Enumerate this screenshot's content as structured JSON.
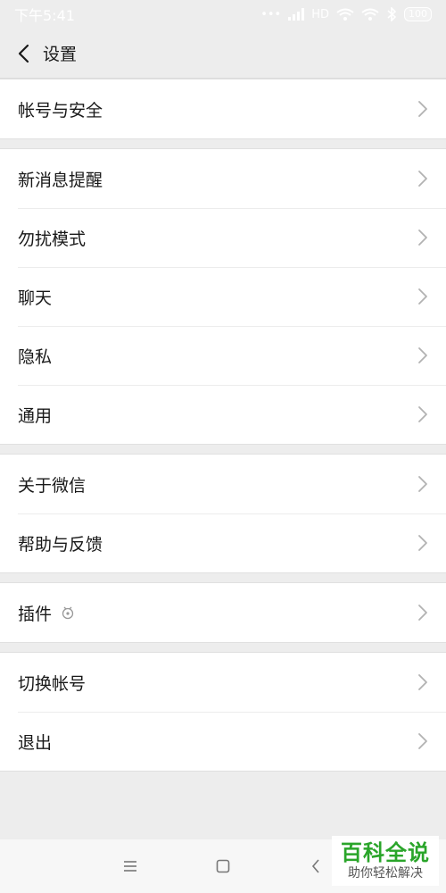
{
  "status_bar": {
    "time": "下午5:41",
    "network": "HD",
    "battery": "100"
  },
  "header": {
    "title": "设置"
  },
  "groups": [
    {
      "items": [
        {
          "label": "帐号与安全"
        }
      ]
    },
    {
      "items": [
        {
          "label": "新消息提醒"
        },
        {
          "label": "勿扰模式"
        },
        {
          "label": "聊天"
        },
        {
          "label": "隐私"
        },
        {
          "label": "通用"
        }
      ]
    },
    {
      "items": [
        {
          "label": "关于微信"
        },
        {
          "label": "帮助与反馈"
        }
      ]
    },
    {
      "items": [
        {
          "label": "插件",
          "icon": "plugin-icon"
        }
      ]
    },
    {
      "items": [
        {
          "label": "切换帐号"
        },
        {
          "label": "退出"
        }
      ]
    }
  ],
  "watermark": {
    "title": "百科全说",
    "subtitle": "助你轻松解决"
  },
  "colors": {
    "background": "#ededed",
    "card": "#ffffff",
    "text": "#191919",
    "chevron": "#b2b2b2",
    "watermark_green": "#2aa52a"
  }
}
